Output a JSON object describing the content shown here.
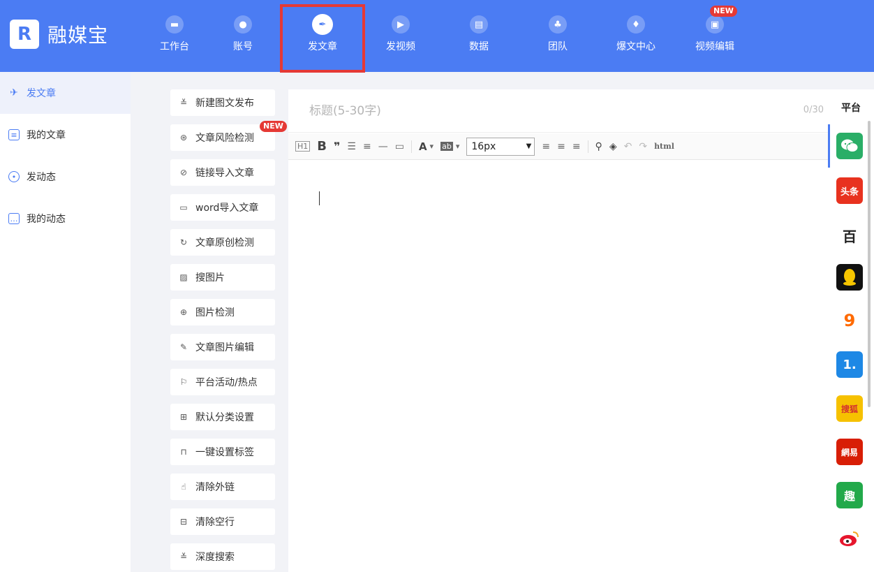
{
  "brand": {
    "logo_mark": "R",
    "name": "融媒宝"
  },
  "nav": {
    "items": [
      {
        "label": "工作台",
        "icon": "monitor-icon"
      },
      {
        "label": "账号",
        "icon": "user-icon"
      },
      {
        "label": "发文章",
        "icon": "feather-icon",
        "active": true
      },
      {
        "label": "发视频",
        "icon": "play-icon"
      },
      {
        "label": "数据",
        "icon": "chart-icon"
      },
      {
        "label": "团队",
        "icon": "team-icon"
      },
      {
        "label": "爆文中心",
        "icon": "fire-icon"
      },
      {
        "label": "视频编辑",
        "icon": "toolbox-icon",
        "badge": "NEW"
      }
    ]
  },
  "sidebar": {
    "items": [
      {
        "label": "发文章",
        "active": true
      },
      {
        "label": "我的文章"
      },
      {
        "label": "发动态"
      },
      {
        "label": "我的动态"
      }
    ]
  },
  "tools": {
    "items": [
      {
        "label": "新建图文发布"
      },
      {
        "label": "文章风险检测",
        "badge": "NEW"
      },
      {
        "label": "链接导入文章"
      },
      {
        "label": "word导入文章"
      },
      {
        "label": "文章原创检测"
      },
      {
        "label": "搜图片"
      },
      {
        "label": "图片检测"
      },
      {
        "label": "文章图片编辑"
      },
      {
        "label": "平台活动/热点"
      },
      {
        "label": "默认分类设置"
      },
      {
        "label": "一键设置标签"
      },
      {
        "label": "清除外链"
      },
      {
        "label": "清除空行"
      },
      {
        "label": "深度搜索"
      }
    ]
  },
  "editor": {
    "title_placeholder": "标题(5-30字)",
    "title_count": "0/30",
    "font_size": "16px",
    "toolbar": {
      "h1": "H1",
      "bold": "B",
      "font_color": "A",
      "bg_color": "ab",
      "html": "html"
    }
  },
  "platforms": {
    "title": "平台",
    "items": [
      {
        "name": "wechat-icon",
        "text": "",
        "color": "#2aae67"
      },
      {
        "name": "toutiao-icon",
        "text": "头条",
        "color": "#e8321f"
      },
      {
        "name": "baijia-icon",
        "text": "百",
        "color": "#ffffff"
      },
      {
        "name": "qq-icon",
        "text": "",
        "color": "#111111"
      },
      {
        "name": "dayu-icon",
        "text": "9",
        "color": "#ffffff"
      },
      {
        "name": "yidian-icon",
        "text": "1.",
        "color": "#1e88e5"
      },
      {
        "name": "sohu-icon",
        "text": "搜狐",
        "color": "#f6c100"
      },
      {
        "name": "netease-icon",
        "text": "網易",
        "color": "#d81e06"
      },
      {
        "name": "qutoutiao-icon",
        "text": "趣",
        "color": "#22a94a"
      },
      {
        "name": "weibo-icon",
        "text": "",
        "color": "#ffffff"
      }
    ]
  },
  "colors": {
    "brand": "#4b7cf3",
    "highlight_box": "#e53935",
    "badge": "#e53935"
  }
}
